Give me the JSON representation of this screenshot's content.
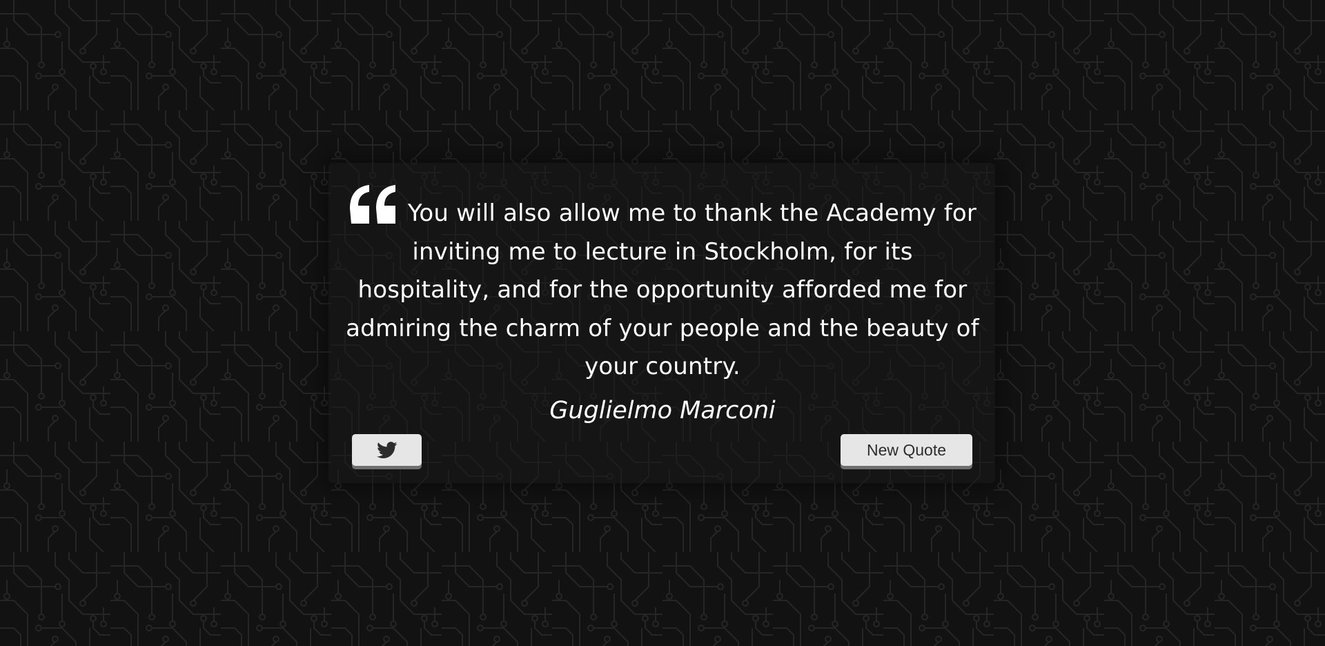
{
  "quote": {
    "text": "You will also allow me to thank the Academy for inviting me to lecture in Stockholm, for its hospitality, and for the opportunity afforded me for admiring the charm of your people and the beauty of your country.",
    "author": "Guglielmo Marconi"
  },
  "buttons": {
    "tweet_icon": "twitter-icon",
    "new_quote_label": "New Quote"
  },
  "icons": {
    "quote_mark": "quote-left-icon"
  },
  "colors": {
    "background": "#111111",
    "text": "#ffffff",
    "button_bg": "#e6e6e6",
    "button_shadow": "#6f6f6f"
  }
}
